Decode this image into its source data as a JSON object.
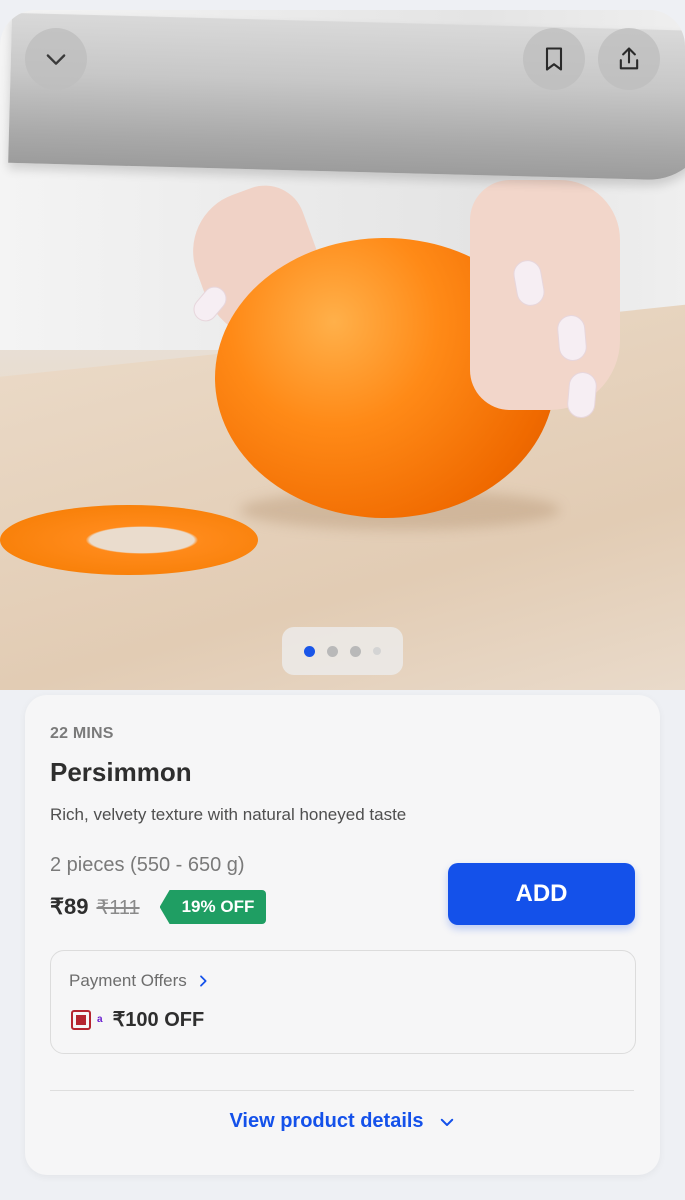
{
  "hero": {
    "icons": {
      "collapse": "chevron-down-icon",
      "bookmark": "bookmark-icon",
      "share": "share-icon"
    },
    "carousel": {
      "total": 4,
      "active": 1
    }
  },
  "product": {
    "eta": "22 MINS",
    "name": "Persimmon",
    "description": "Rich, velvety texture with natural honeyed taste",
    "quantity": "2 pieces (550 - 650 g)",
    "price": "₹89",
    "mrp": "₹111",
    "discount": "19% OFF",
    "add_label": "ADD"
  },
  "offers": {
    "heading": "Payment Offers",
    "offer_value": "₹100 OFF",
    "bank_mark": "a"
  },
  "footer": {
    "view_details": "View product details"
  },
  "colors": {
    "accent": "#1451ea",
    "discount": "#1f9e63"
  }
}
